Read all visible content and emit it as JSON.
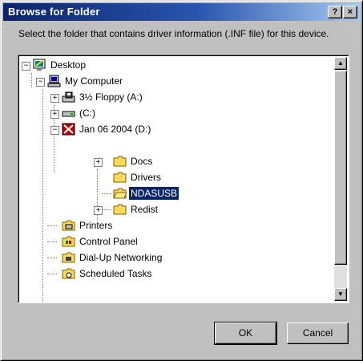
{
  "window": {
    "title": "Browse for Folder",
    "help_label": "?",
    "close_label": "×"
  },
  "instruction": "Select the folder that contains driver information (.INF file) for this device.",
  "tree": {
    "items": [
      {
        "label": "Desktop",
        "icon": "desktop-icon",
        "expander": "−"
      },
      {
        "label": "My Computer",
        "icon": "computer-icon",
        "expander": "−"
      },
      {
        "label": "3½ Floppy (A:)",
        "icon": "floppy-drive-icon",
        "expander": "+"
      },
      {
        "label": "(C:)",
        "icon": "hard-drive-icon",
        "expander": "+"
      },
      {
        "label": "Jan 06 2004 (D:)",
        "icon": "cd-drive-icon",
        "expander": "−"
      },
      {
        "label": "Docs",
        "icon": "folder-icon",
        "expander": "+"
      },
      {
        "label": "Drivers",
        "icon": "folder-icon",
        "expander": ""
      },
      {
        "label": "NDASUSB",
        "icon": "folder-open-icon",
        "expander": "",
        "selected": true
      },
      {
        "label": "Redist",
        "icon": "folder-icon",
        "expander": "+"
      },
      {
        "label": "Printers",
        "icon": "printers-folder-icon",
        "expander": ""
      },
      {
        "label": "Control Panel",
        "icon": "control-panel-icon",
        "expander": ""
      },
      {
        "label": "Dial-Up Networking",
        "icon": "dialup-networking-icon",
        "expander": ""
      },
      {
        "label": "Scheduled Tasks",
        "icon": "scheduled-tasks-icon",
        "expander": ""
      }
    ]
  },
  "scrollbar": {
    "up": "▲",
    "down": "▼"
  },
  "buttons": {
    "ok": "OK",
    "cancel": "Cancel"
  },
  "colors": {
    "titlebar": "#0a246a",
    "selection": "#0a246a",
    "folder": "#ffd95a",
    "face": "#c0c0c0"
  }
}
